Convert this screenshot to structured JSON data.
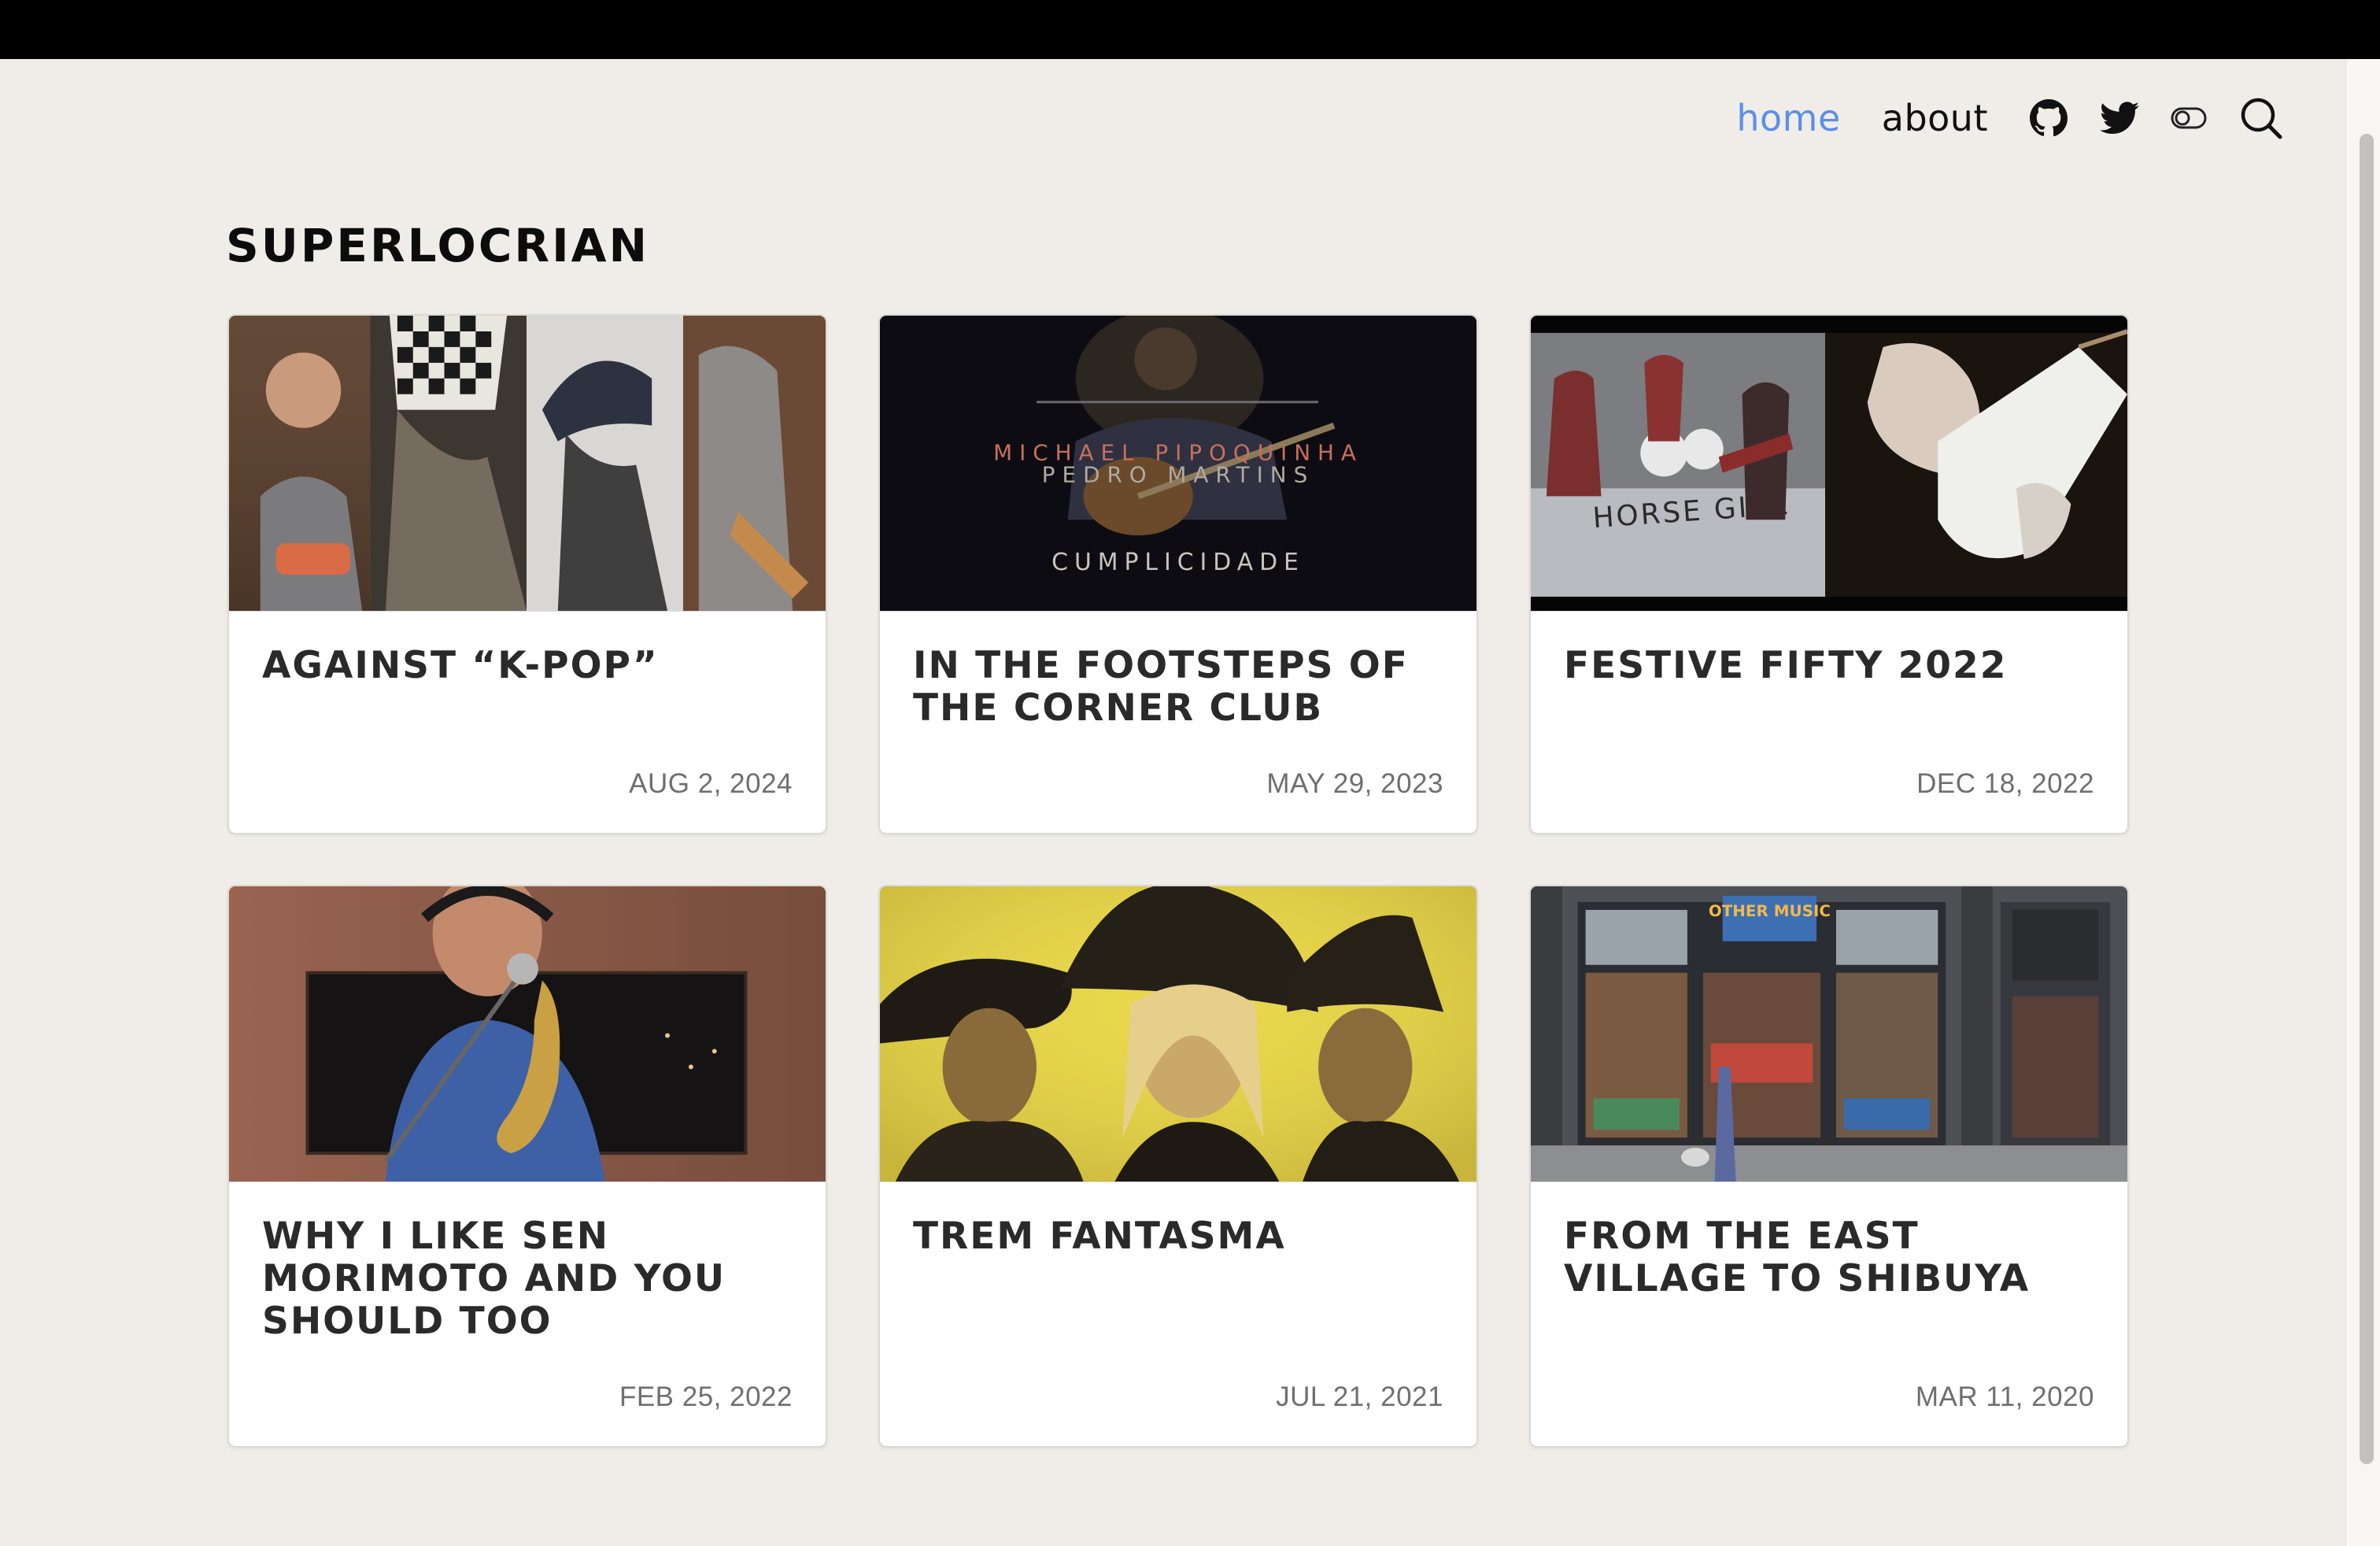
{
  "nav": {
    "home_label": "home",
    "about_label": "about",
    "icons": [
      "github-icon",
      "twitter-icon",
      "theme-toggle-icon",
      "search-icon"
    ]
  },
  "site": {
    "title": "SUPERLOCRIAN"
  },
  "posts": [
    {
      "title": "AGAINST “K-POP”",
      "date": "AUG 2, 2024"
    },
    {
      "title": "IN THE FOOTSTEPS OF THE CORNER CLUB",
      "date": "MAY 29, 2023",
      "image_text": {
        "line1": "MICHAEL PIPOQUINHA",
        "line2": "PEDRO MARTINS",
        "line3": "CUMPLICIDADE"
      }
    },
    {
      "title": "FESTIVE FIFTY 2022",
      "date": "DEC 18, 2022",
      "image_text": {
        "banner": "HORSE GIRL"
      }
    },
    {
      "title": "WHY I LIKE SEN MORIMOTO AND YOU SHOULD TOO",
      "date": "FEB 25, 2022"
    },
    {
      "title": "TREM FANTASMA",
      "date": "JUL 21, 2021"
    },
    {
      "title": "FROM THE EAST VILLAGE TO SHIBUYA",
      "date": "MAR 11, 2020",
      "image_text": {
        "sign": "OTHER MUSIC"
      }
    }
  ],
  "colors": {
    "background": "#f0ede8",
    "nav_active": "#5b8fe6",
    "title": "#0c0c0c",
    "card_title": "#2a2a2a",
    "card_date": "#6f6f6f"
  }
}
